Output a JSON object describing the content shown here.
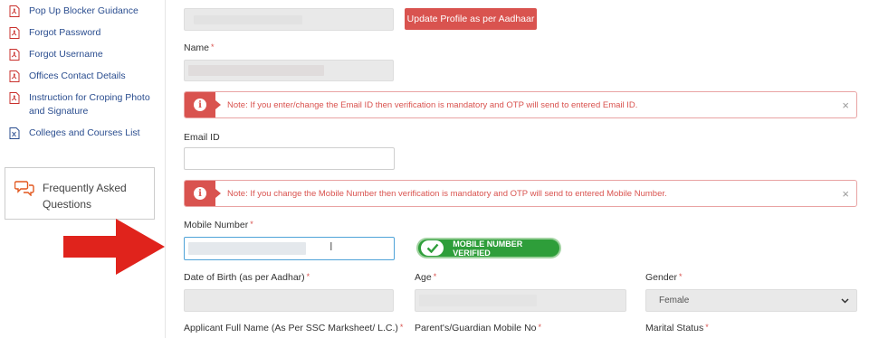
{
  "sidebar": {
    "links": [
      {
        "label": "Pop Up Blocker Guidance",
        "icon": "pdf-icon"
      },
      {
        "label": "Forgot Password",
        "icon": "pdf-icon"
      },
      {
        "label": "Forgot Username",
        "icon": "pdf-icon"
      },
      {
        "label": "Offices Contact Details",
        "icon": "pdf-icon"
      },
      {
        "label": "Instruction for Croping Photo and Signature",
        "icon": "pdf-icon"
      },
      {
        "label": "Colleges and Courses List",
        "icon": "excel-icon"
      }
    ],
    "faq": {
      "label": "Frequently Asked Questions",
      "icon": "chat-bubbles-icon"
    }
  },
  "form": {
    "update_button": "Update Profile as per Aadhaar",
    "name_label": "Name",
    "email_note": "Note: If you enter/change the Email ID then verification is mandatory and OTP will send to entered Email ID.",
    "email_label": "Email ID",
    "email_value": "",
    "mobile_note": "Note: If you change the Mobile Number then verification is mandatory and OTP will send to entered Mobile Number.",
    "mobile_label": "Mobile Number",
    "mobile_status": "MOBILE NUMBER VERIFIED",
    "dob_label": "Date of Birth (as per Aadhar)",
    "age_label": "Age",
    "gender_label": "Gender",
    "gender_value": "Female",
    "fullname_label": "Applicant Full Name (As Per SSC Marksheet/ L.C.)",
    "guardian_label": "Parent's/Guardian Mobile No",
    "marital_label": "Marital Status",
    "required_mark": "*",
    "close_glyph": "×",
    "info_glyph": "i"
  },
  "colors": {
    "accent_red": "#d9534f",
    "link_blue": "#2a4d8f",
    "verified_green": "#2e9e3a",
    "arrow_red": "#e0231c"
  }
}
